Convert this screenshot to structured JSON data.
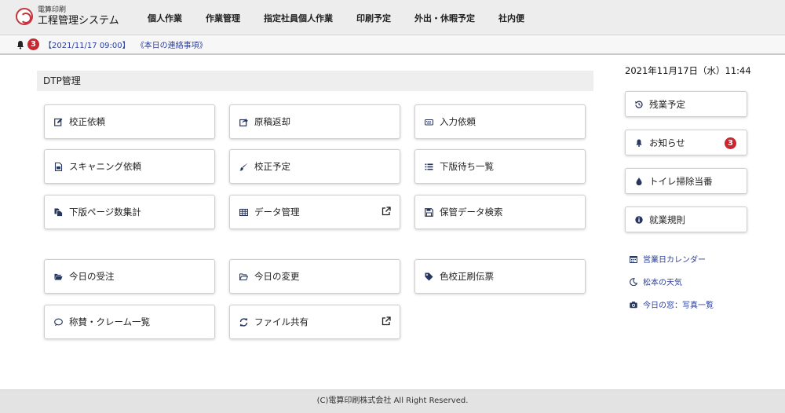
{
  "header": {
    "logo_top": "電算印刷",
    "logo_main": "工程管理システム",
    "nav": [
      "個人作業",
      "作業管理",
      "指定社員個人作業",
      "印刷予定",
      "外出・休暇予定",
      "社内便"
    ]
  },
  "notice": {
    "count": "3",
    "datetime": "【2021/11/17 09:00】",
    "link": "《本日の連絡事項》"
  },
  "section": {
    "title": "DTP管理"
  },
  "tiles": [
    {
      "label": "校正依頼",
      "icon": "edit-icon"
    },
    {
      "label": "原稿返却",
      "icon": "share-icon"
    },
    {
      "label": "入力依頼",
      "icon": "keyboard-icon"
    },
    {
      "label": "スキャニング依頼",
      "icon": "image-file-icon"
    },
    {
      "label": "校正予定",
      "icon": "brush-icon"
    },
    {
      "label": "下版待ち一覧",
      "icon": "list-icon"
    },
    {
      "label": "下版ページ数集計",
      "icon": "copy-icon"
    },
    {
      "label": "データ管理",
      "icon": "table-icon"
    },
    {
      "label": "保管データ検索",
      "icon": "save-icon"
    },
    {
      "label": "今日の受注",
      "icon": "folder-open-icon"
    },
    {
      "label": "今日の変更",
      "icon": "folder-outline-icon"
    },
    {
      "label": "色校正刷伝票",
      "icon": "tag-icon"
    },
    {
      "label": "称賛・クレーム一覧",
      "icon": "comment-icon"
    },
    {
      "label": "ファイル共有",
      "icon": "sync-icon"
    }
  ],
  "sidebar": {
    "clock": "2021年11月17日（水）11:44",
    "buttons": [
      {
        "label": "残業予定",
        "icon": "history-icon"
      },
      {
        "label": "お知らせ",
        "icon": "bell-icon",
        "badge": "3"
      },
      {
        "label": "トイレ掃除当番",
        "icon": "drop-icon"
      },
      {
        "label": "就業規則",
        "icon": "info-icon"
      }
    ],
    "links": [
      {
        "label": "営業日カレンダー",
        "icon": "calendar-icon"
      },
      {
        "label": "松本の天気",
        "icon": "moon-icon"
      },
      {
        "label": "今日の窓：写真一覧",
        "icon": "camera-icon"
      }
    ]
  },
  "footer": {
    "text": "(C)電算印刷株式会社 All Right Reserved."
  },
  "colors": {
    "accent_red": "#c9262f",
    "link_blue": "#2b3f9e",
    "icon_navy": "#26365e"
  }
}
